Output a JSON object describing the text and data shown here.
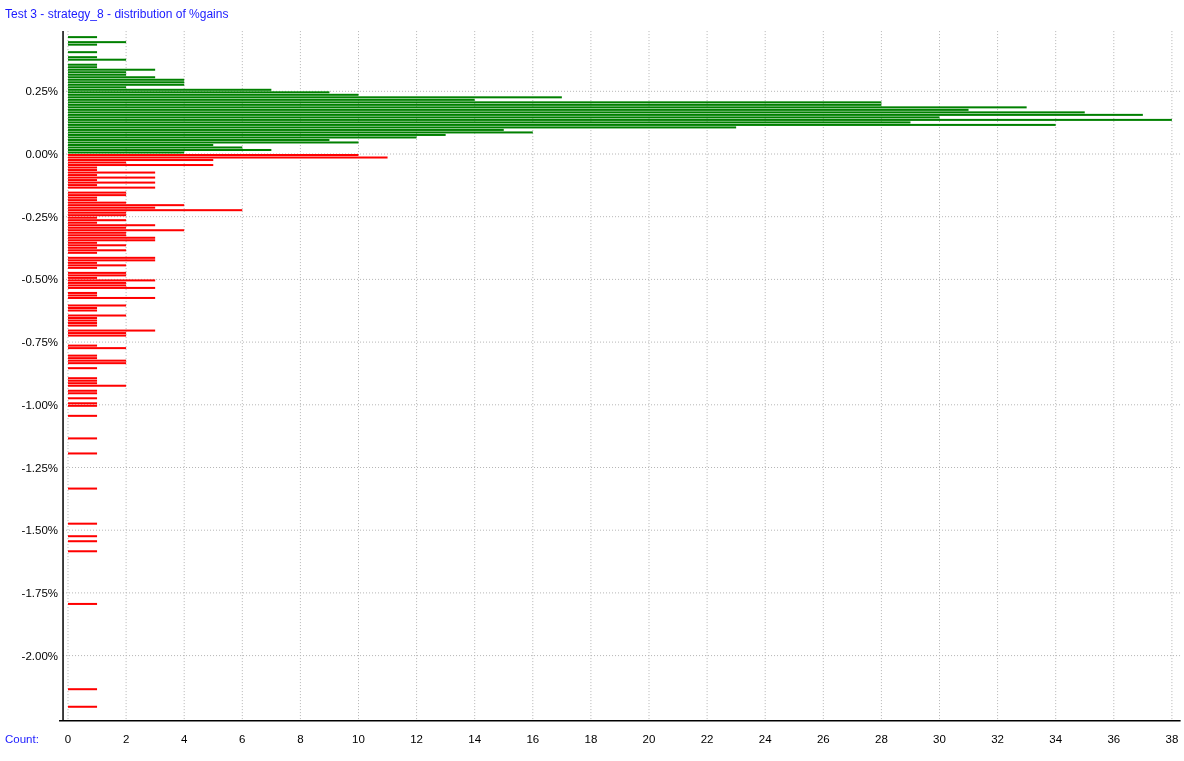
{
  "chart": {
    "chart_data": {
      "type": "bar",
      "grid": true,
      "orientation": "horizontal",
      "title": "Test 3 - strategy_8 - distribution of %gains",
      "xlabel": "Count:",
      "xlim": [
        -0.15,
        38.3
      ],
      "ylim": [
        -2.26,
        0.49
      ],
      "xticks": [
        0,
        2,
        4,
        6,
        8,
        10,
        12,
        14,
        16,
        18,
        20,
        22,
        24,
        26,
        28,
        30,
        32,
        34,
        36,
        38
      ],
      "yticks": [
        {
          "value": 0.25,
          "label": "0.25%"
        },
        {
          "value": 0,
          "label": "0.00%"
        },
        {
          "value": -0.25,
          "label": "-0.25%"
        },
        {
          "value": -0.5,
          "label": "-0.50%"
        },
        {
          "value": -0.75,
          "label": "-0.75%"
        },
        {
          "value": -1,
          "label": "-1.00%"
        },
        {
          "value": -1.25,
          "label": "-1.25%"
        },
        {
          "value": -1.5,
          "label": "-1.50%"
        },
        {
          "value": -1.75,
          "label": "-1.75%"
        },
        {
          "value": -2,
          "label": "-2.00%"
        }
      ],
      "x": [
        0.46,
        0.44,
        0.43,
        0.4,
        0.38,
        0.37,
        0.35,
        0.34,
        0.33,
        0.32,
        0.31,
        0.3,
        0.29,
        0.28,
        0.27,
        0.26,
        0.25,
        0.24,
        0.23,
        0.22,
        0.21,
        0.2,
        0.19,
        0.18,
        0.17,
        0.16,
        0.15,
        0.14,
        0.13,
        0.12,
        0.11,
        0.1,
        0.09,
        0.08,
        0.07,
        0.06,
        0.05,
        0.04,
        0.03,
        0.02,
        0.01,
        0.0,
        -0.01,
        -0.02,
        -0.03,
        -0.04,
        -0.05,
        -0.06,
        -0.07,
        -0.08,
        -0.09,
        -0.1,
        -0.11,
        -0.12,
        -0.13,
        -0.14,
        -0.16,
        -0.17,
        -0.18,
        -0.19,
        -0.2,
        -0.21,
        -0.22,
        -0.23,
        -0.24,
        -0.25,
        -0.26,
        -0.27,
        -0.28,
        -0.29,
        -0.3,
        -0.31,
        -0.32,
        -0.33,
        -0.34,
        -0.35,
        -0.36,
        -0.37,
        -0.38,
        -0.39,
        -0.4,
        -0.42,
        -0.43,
        -0.44,
        -0.45,
        -0.46,
        -0.48,
        -0.49,
        -0.5,
        -0.51,
        -0.52,
        -0.53,
        -0.54,
        -0.56,
        -0.57,
        -0.58,
        -0.61,
        -0.62,
        -0.63,
        -0.65,
        -0.66,
        -0.67,
        -0.68,
        -0.69,
        -0.71,
        -0.72,
        -0.73,
        -0.77,
        -0.78,
        -0.81,
        -0.82,
        -0.83,
        -0.84,
        -0.86,
        -0.9,
        -0.91,
        -0.92,
        -0.93,
        -0.95,
        -0.96,
        -0.98,
        -1.0,
        -1.01,
        -1.05,
        -1.14,
        -1.2,
        -1.34,
        -1.48,
        -1.53,
        -1.55,
        -1.59,
        -1.8,
        -2.14,
        -2.21
      ],
      "values": [
        1,
        2,
        1,
        1,
        1,
        2,
        1,
        1,
        3,
        2,
        2,
        3,
        4,
        4,
        4,
        2,
        7,
        9,
        10,
        17,
        14,
        28,
        28,
        33,
        31,
        35,
        37,
        30,
        38,
        29,
        34,
        23,
        15,
        16,
        13,
        12,
        9,
        10,
        5,
        6,
        7,
        4,
        10,
        11,
        5,
        2,
        5,
        1,
        1,
        3,
        1,
        3,
        1,
        3,
        1,
        3,
        2,
        2,
        1,
        1,
        2,
        4,
        3,
        6,
        2,
        2,
        1,
        2,
        1,
        3,
        2,
        4,
        2,
        2,
        3,
        3,
        1,
        2,
        1,
        2,
        1,
        3,
        3,
        1,
        2,
        1,
        2,
        2,
        1,
        3,
        2,
        2,
        3,
        1,
        1,
        3,
        2,
        1,
        1,
        2,
        1,
        1,
        1,
        1,
        3,
        2,
        2,
        1,
        2,
        1,
        1,
        2,
        2,
        1,
        1,
        1,
        1,
        2,
        1,
        1,
        1,
        1,
        1,
        1,
        1,
        1,
        1,
        1,
        1,
        1,
        1,
        1,
        1,
        1
      ]
    }
  }
}
